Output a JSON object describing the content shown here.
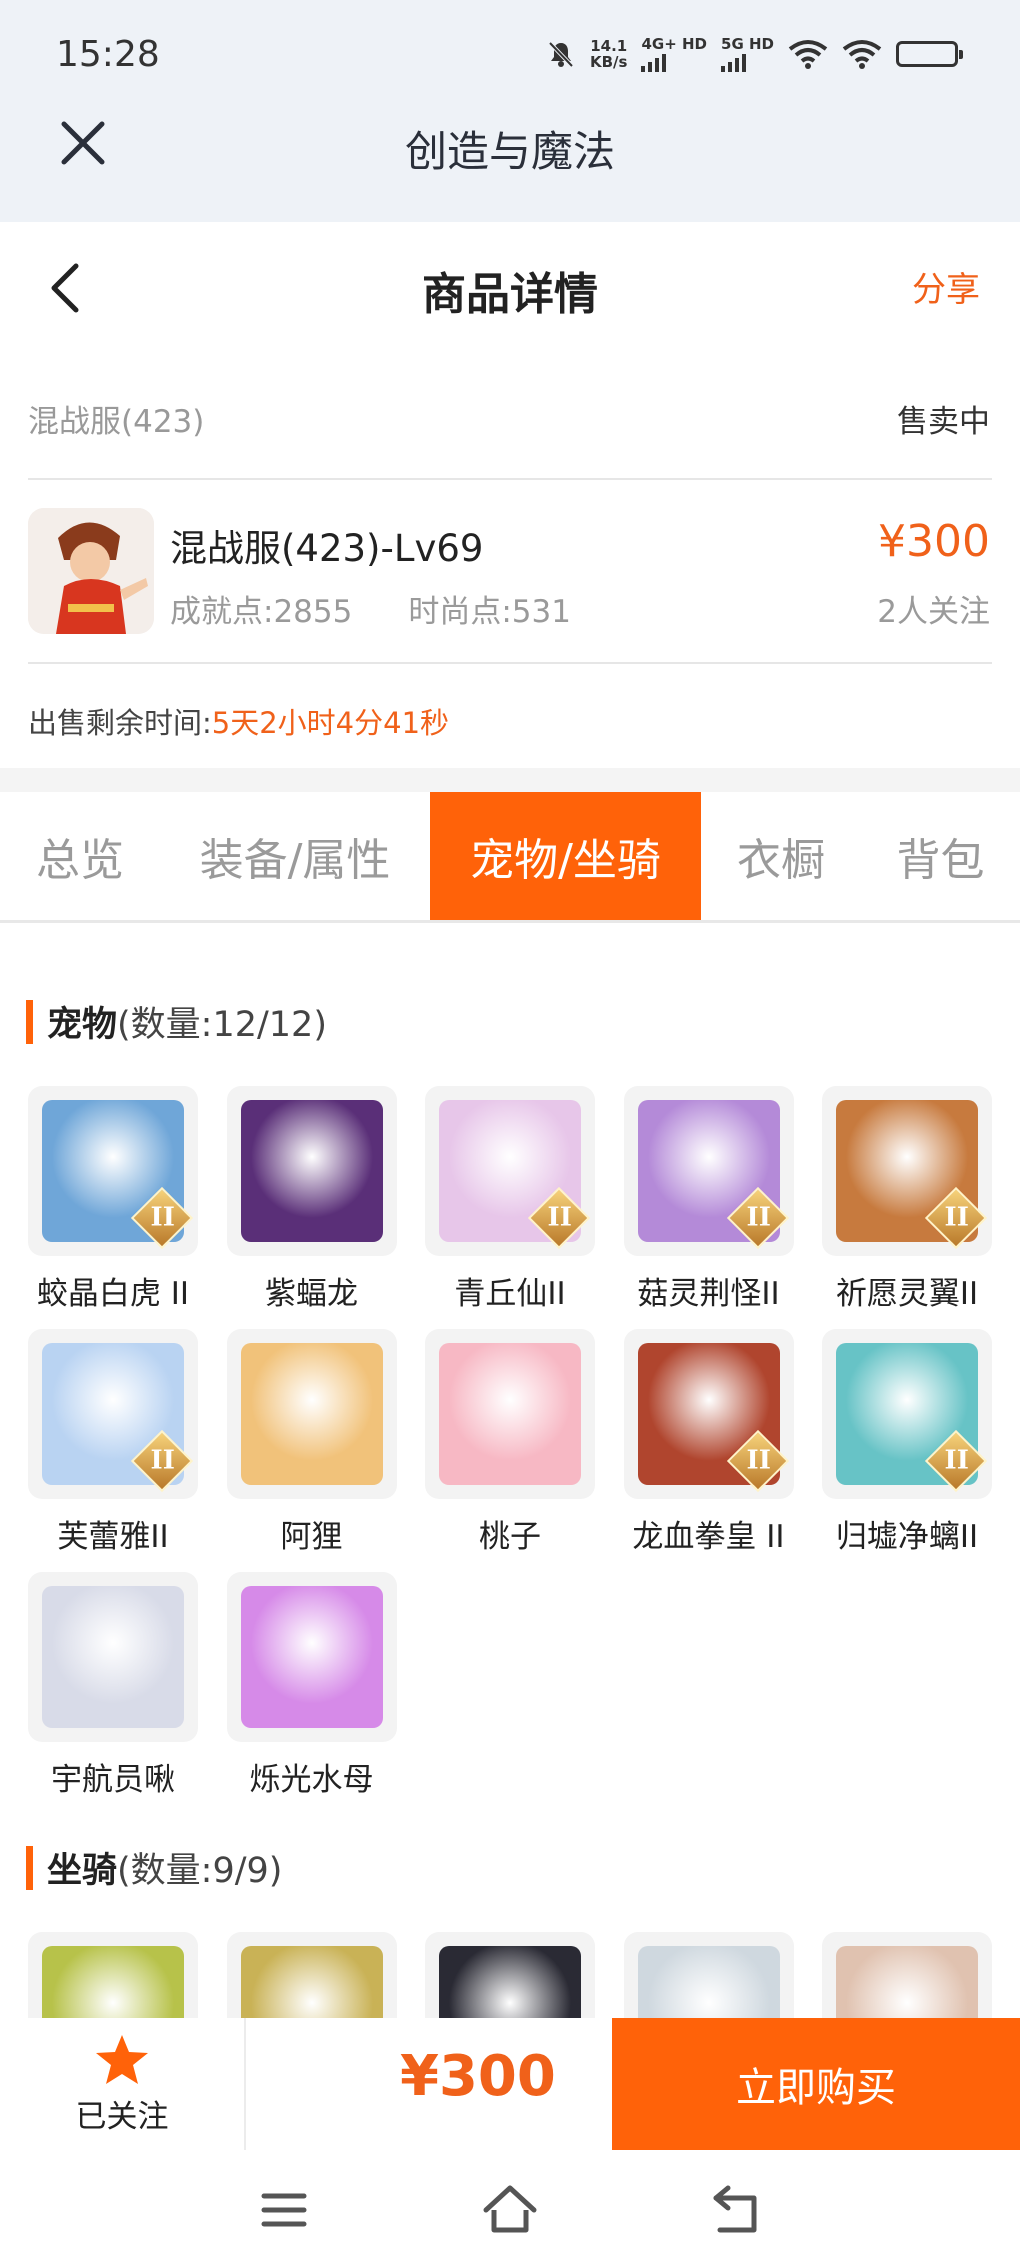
{
  "status_bar": {
    "time": "15:28",
    "net_speed_value": "14.1",
    "net_speed_unit": "KB/s",
    "sim1": "4G+ HD",
    "sim2": "5G HD"
  },
  "app_bar": {
    "title": "创造与魔法"
  },
  "header": {
    "title": "商品详情",
    "share": "分享"
  },
  "listing": {
    "server": "混战服(423)",
    "status": "售卖中",
    "character_name": "混战服(423)-Lv69",
    "achievement": "成就点:2855",
    "fashion": "时尚点:531",
    "price": "¥300",
    "followers": "2人关注",
    "remain_label": "出售剩余时间:",
    "remain_value": "5天2小时4分41秒"
  },
  "tabs": [
    "总览",
    "装备/属性",
    "宠物/坐骑",
    "衣橱",
    "背包"
  ],
  "pets": {
    "title": "宠物",
    "count": "(数量:12/12)",
    "items": [
      {
        "label": "蛟晶白虎 II",
        "badge": "II",
        "color": "#6fa6d8"
      },
      {
        "label": "紫蝠龙",
        "badge": "",
        "color": "#5a2f78"
      },
      {
        "label": "青丘仙II",
        "badge": "II",
        "color": "#e7c6e9"
      },
      {
        "label": "菇灵荆怪II",
        "badge": "II",
        "color": "#b48ad8"
      },
      {
        "label": "祈愿灵翼II",
        "badge": "II",
        "color": "#c77a3e"
      },
      {
        "label": "芙蕾雅II",
        "badge": "II",
        "color": "#b9d3f2"
      },
      {
        "label": "阿狸",
        "badge": "",
        "color": "#f1c27a"
      },
      {
        "label": "桃子",
        "badge": "",
        "color": "#f7b8c4"
      },
      {
        "label": "龙血拳皇 II",
        "badge": "II",
        "color": "#b0452e"
      },
      {
        "label": "归墟净螭II",
        "badge": "II",
        "color": "#67c3c6"
      },
      {
        "label": "宇航员啾",
        "badge": "",
        "color": "#d8dbe8"
      },
      {
        "label": "烁光水母",
        "badge": "",
        "color": "#d68ae8"
      }
    ]
  },
  "mounts": {
    "title": "坐骑",
    "count": "(数量:9/9)",
    "items": [
      {
        "color": "#b7c24a"
      },
      {
        "color": "#c9b256"
      },
      {
        "color": "#2a2a34"
      },
      {
        "color": "#cfd8df"
      },
      {
        "color": "#e0c2b0"
      }
    ]
  },
  "bottom": {
    "follow_label": "已关注",
    "price": "¥300",
    "buy_label": "立即购买"
  }
}
